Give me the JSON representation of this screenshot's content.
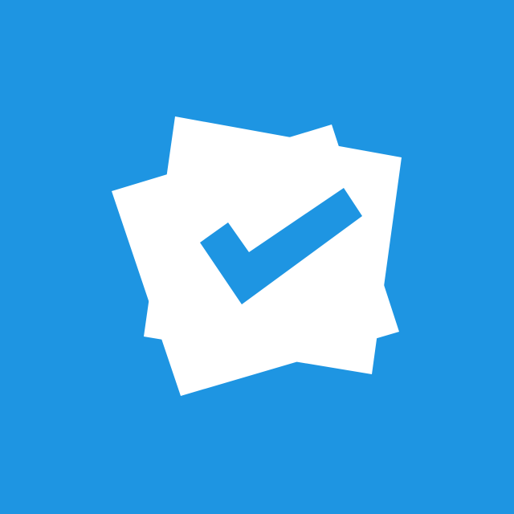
{
  "icon": {
    "name": "checklist-app-icon",
    "glyph": "check-mark-icon",
    "colors": {
      "background": "#1E95E2",
      "paper": "#FFFFFF",
      "check": "#1E95E2"
    }
  }
}
